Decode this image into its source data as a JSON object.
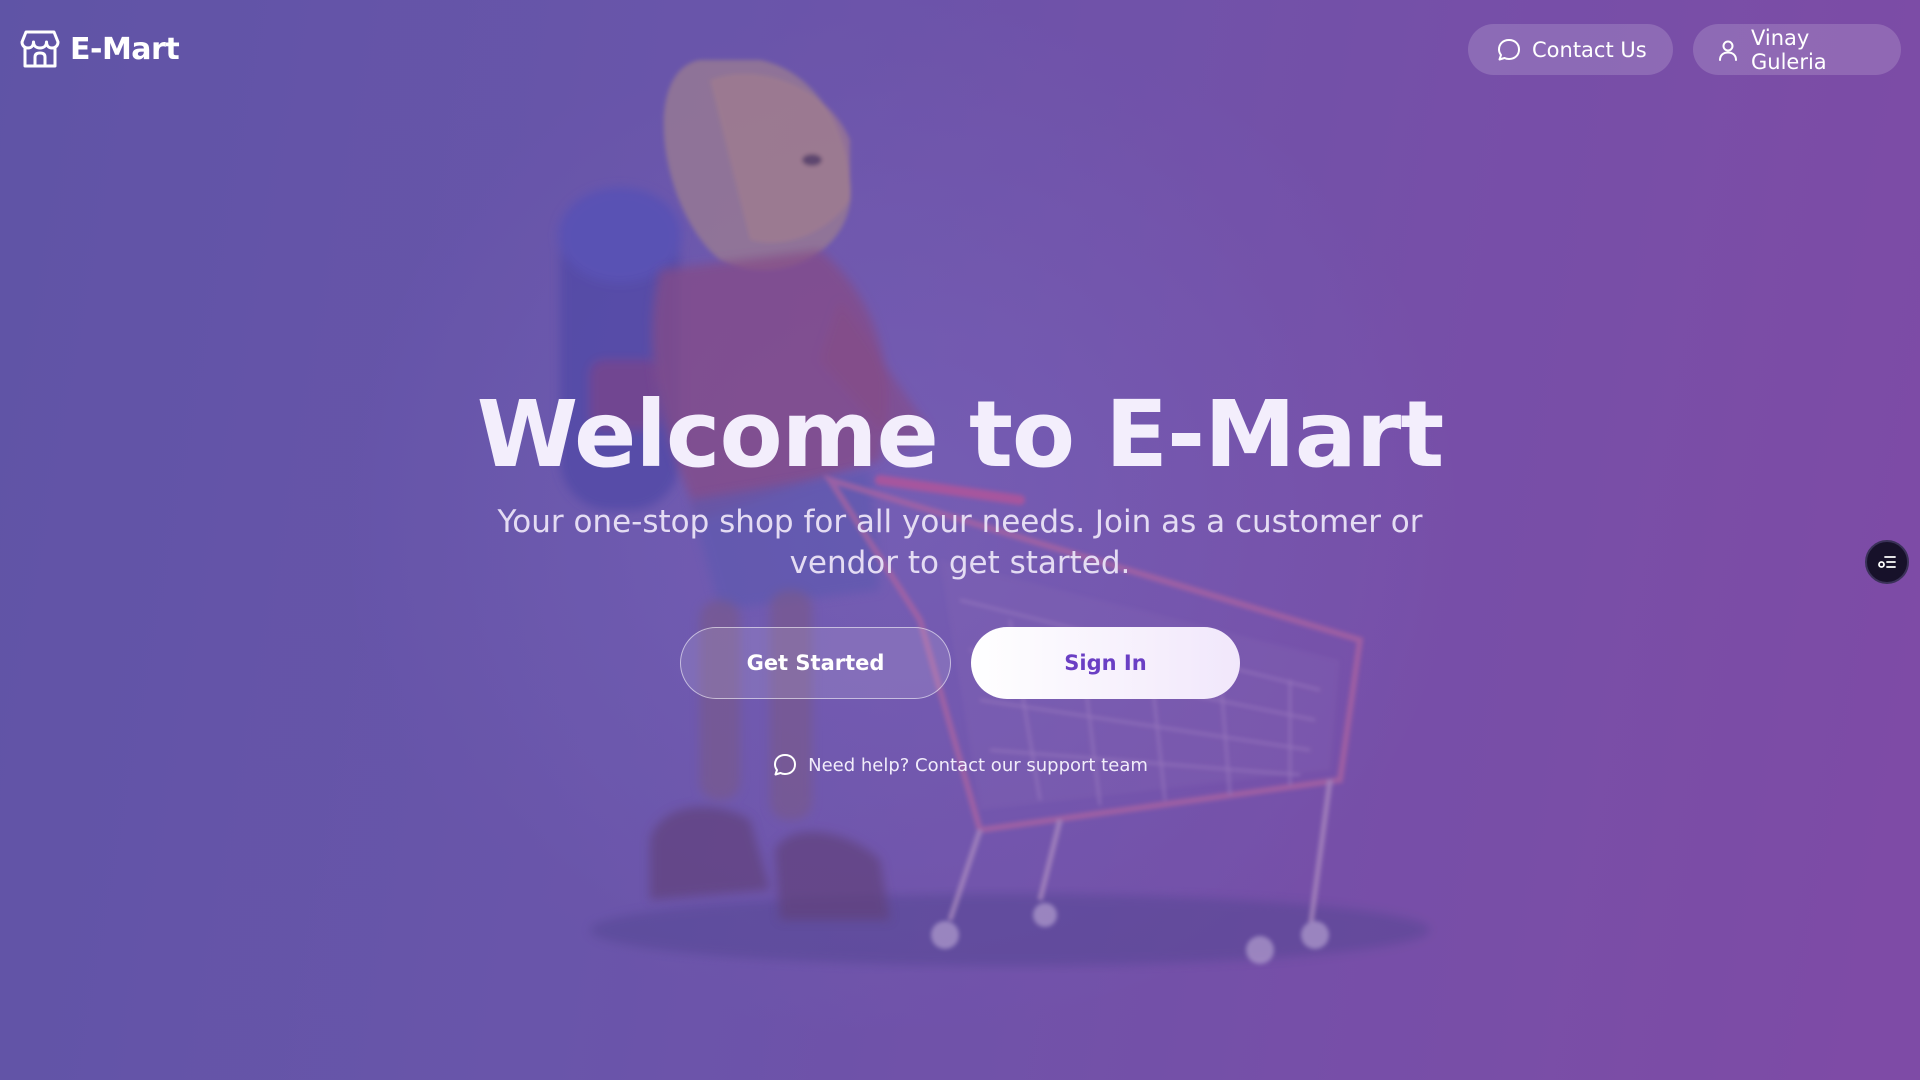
{
  "header": {
    "brand_name": "E-Mart",
    "brand_icon": "store-icon",
    "contact_label": "Contact Us",
    "contact_icon": "chat-bubble-icon",
    "user_name": "Vinay Guleria",
    "user_icon": "user-icon"
  },
  "hero": {
    "title": "Welcome to E-Mart",
    "subtitle": "Your one-stop shop for all your needs. Join as a customer or vendor to get started.",
    "get_started_label": "Get Started",
    "sign_in_label": "Sign In",
    "help_text": "Need help? Contact our support team",
    "help_icon": "chat-bubble-icon"
  },
  "widget": {
    "icon": "assistant-widget-icon"
  },
  "colors": {
    "background_start": "#5d55a5",
    "background_end": "#8549a4",
    "sign_in_text": "#6a3fc4"
  }
}
